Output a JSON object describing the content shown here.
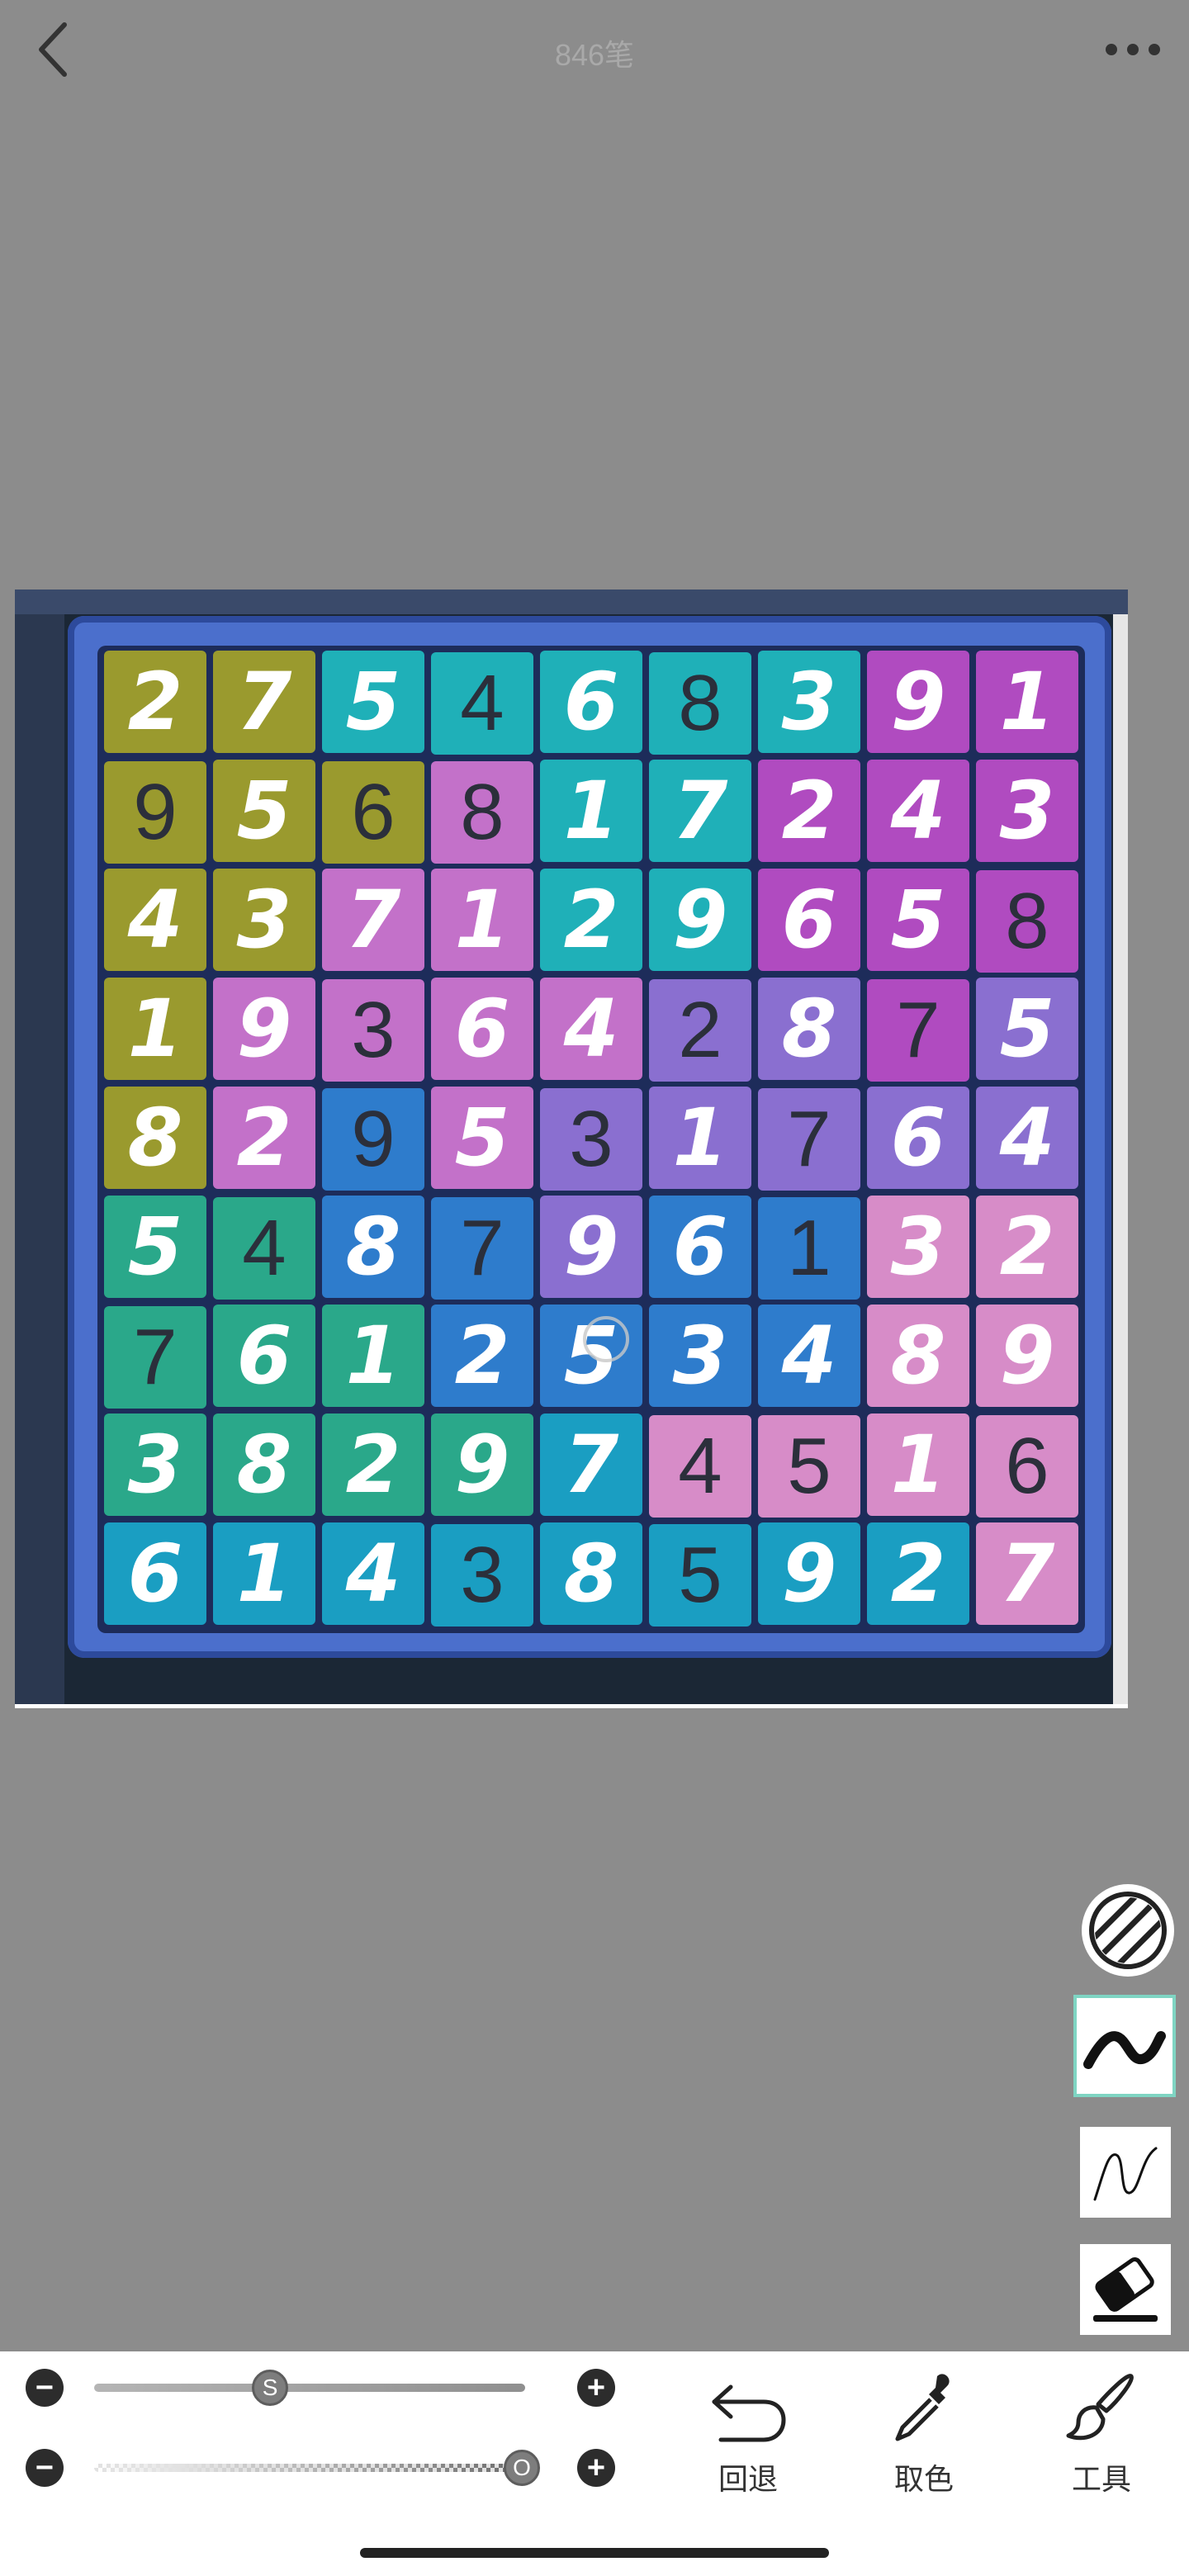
{
  "header": {
    "title": "846笔",
    "back_icon": "chevron-left-icon",
    "more_icon": "more-horizontal-icon"
  },
  "board": {
    "rows": [
      [
        {
          "d": "2",
          "h": true,
          "bg": "#9a9a2e"
        },
        {
          "d": "7",
          "h": true,
          "bg": "#9a9a2e"
        },
        {
          "d": "5",
          "h": true,
          "bg": "#1fb0b8"
        },
        {
          "d": "4",
          "h": false,
          "bg": "#1fb0b8"
        },
        {
          "d": "6",
          "h": true,
          "bg": "#1fb0b8"
        },
        {
          "d": "8",
          "h": false,
          "bg": "#1fb0b8"
        },
        {
          "d": "3",
          "h": true,
          "bg": "#1fb0b8"
        },
        {
          "d": "9",
          "h": true,
          "bg": "#b04bc0"
        },
        {
          "d": "1",
          "h": true,
          "bg": "#b04bc0"
        }
      ],
      [
        {
          "d": "9",
          "h": false,
          "bg": "#9a9a2e"
        },
        {
          "d": "5",
          "h": true,
          "bg": "#9a9a2e"
        },
        {
          "d": "6",
          "h": false,
          "bg": "#9a9a2e"
        },
        {
          "d": "8",
          "h": false,
          "bg": "#c371c9"
        },
        {
          "d": "1",
          "h": true,
          "bg": "#1fb0b8"
        },
        {
          "d": "7",
          "h": true,
          "bg": "#1fb0b8"
        },
        {
          "d": "2",
          "h": true,
          "bg": "#b04bc0"
        },
        {
          "d": "4",
          "h": true,
          "bg": "#b04bc0"
        },
        {
          "d": "3",
          "h": true,
          "bg": "#b04bc0"
        }
      ],
      [
        {
          "d": "4",
          "h": true,
          "bg": "#9a9a2e"
        },
        {
          "d": "3",
          "h": true,
          "bg": "#9a9a2e"
        },
        {
          "d": "7",
          "h": true,
          "bg": "#c371c9"
        },
        {
          "d": "1",
          "h": true,
          "bg": "#c371c9"
        },
        {
          "d": "2",
          "h": true,
          "bg": "#1fb0b8"
        },
        {
          "d": "9",
          "h": true,
          "bg": "#1fb0b8"
        },
        {
          "d": "6",
          "h": true,
          "bg": "#b04bc0"
        },
        {
          "d": "5",
          "h": true,
          "bg": "#b04bc0"
        },
        {
          "d": "8",
          "h": false,
          "bg": "#b04bc0"
        }
      ],
      [
        {
          "d": "1",
          "h": true,
          "bg": "#9a9a2e"
        },
        {
          "d": "9",
          "h": true,
          "bg": "#c371c9"
        },
        {
          "d": "3",
          "h": false,
          "bg": "#c371c9"
        },
        {
          "d": "6",
          "h": true,
          "bg": "#c371c9"
        },
        {
          "d": "4",
          "h": true,
          "bg": "#c371c9"
        },
        {
          "d": "2",
          "h": false,
          "bg": "#8a6fd0"
        },
        {
          "d": "8",
          "h": true,
          "bg": "#8a6fd0"
        },
        {
          "d": "7",
          "h": false,
          "bg": "#b04bc0"
        },
        {
          "d": "5",
          "h": true,
          "bg": "#8a6fd0"
        }
      ],
      [
        {
          "d": "8",
          "h": true,
          "bg": "#9a9a2e"
        },
        {
          "d": "2",
          "h": true,
          "bg": "#c371c9"
        },
        {
          "d": "9",
          "h": false,
          "bg": "#2e7ccc"
        },
        {
          "d": "5",
          "h": true,
          "bg": "#c371c9"
        },
        {
          "d": "3",
          "h": false,
          "bg": "#8a6fd0"
        },
        {
          "d": "1",
          "h": true,
          "bg": "#8a6fd0"
        },
        {
          "d": "7",
          "h": false,
          "bg": "#8a6fd0"
        },
        {
          "d": "6",
          "h": true,
          "bg": "#8a6fd0"
        },
        {
          "d": "4",
          "h": true,
          "bg": "#8a6fd0"
        }
      ],
      [
        {
          "d": "5",
          "h": true,
          "bg": "#2aa88a"
        },
        {
          "d": "4",
          "h": false,
          "bg": "#2aa88a"
        },
        {
          "d": "8",
          "h": true,
          "bg": "#2e7ccc"
        },
        {
          "d": "7",
          "h": false,
          "bg": "#2e7ccc"
        },
        {
          "d": "9",
          "h": true,
          "bg": "#8a6fd0"
        },
        {
          "d": "6",
          "h": true,
          "bg": "#2e7ccc"
        },
        {
          "d": "1",
          "h": false,
          "bg": "#2e7ccc"
        },
        {
          "d": "3",
          "h": true,
          "bg": "#d78cc8"
        },
        {
          "d": "2",
          "h": true,
          "bg": "#d78cc8"
        }
      ],
      [
        {
          "d": "7",
          "h": false,
          "bg": "#2aa88a"
        },
        {
          "d": "6",
          "h": true,
          "bg": "#2aa88a"
        },
        {
          "d": "1",
          "h": true,
          "bg": "#2aa88a"
        },
        {
          "d": "2",
          "h": true,
          "bg": "#2e7ccc"
        },
        {
          "d": "5",
          "h": true,
          "bg": "#2e7ccc"
        },
        {
          "d": "3",
          "h": true,
          "bg": "#2e7ccc"
        },
        {
          "d": "4",
          "h": true,
          "bg": "#2e7ccc"
        },
        {
          "d": "8",
          "h": true,
          "bg": "#d78cc8"
        },
        {
          "d": "9",
          "h": true,
          "bg": "#d78cc8"
        }
      ],
      [
        {
          "d": "3",
          "h": true,
          "bg": "#2aa88a"
        },
        {
          "d": "8",
          "h": true,
          "bg": "#2aa88a"
        },
        {
          "d": "2",
          "h": true,
          "bg": "#2aa88a"
        },
        {
          "d": "9",
          "h": true,
          "bg": "#2aa88a"
        },
        {
          "d": "7",
          "h": true,
          "bg": "#1a9ec2"
        },
        {
          "d": "4",
          "h": false,
          "bg": "#d78cc8"
        },
        {
          "d": "5",
          "h": false,
          "bg": "#d78cc8"
        },
        {
          "d": "1",
          "h": true,
          "bg": "#d78cc8"
        },
        {
          "d": "6",
          "h": false,
          "bg": "#d78cc8"
        }
      ],
      [
        {
          "d": "6",
          "h": true,
          "bg": "#1a9ec2"
        },
        {
          "d": "1",
          "h": true,
          "bg": "#1a9ec2"
        },
        {
          "d": "4",
          "h": true,
          "bg": "#1a9ec2"
        },
        {
          "d": "3",
          "h": false,
          "bg": "#1a9ec2"
        },
        {
          "d": "8",
          "h": true,
          "bg": "#1a9ec2"
        },
        {
          "d": "5",
          "h": false,
          "bg": "#1a9ec2"
        },
        {
          "d": "9",
          "h": true,
          "bg": "#1a9ec2"
        },
        {
          "d": "2",
          "h": true,
          "bg": "#1a9ec2"
        },
        {
          "d": "7",
          "h": true,
          "bg": "#d78cc8"
        }
      ]
    ]
  },
  "tools": {
    "pattern_icon": "hatch-pattern-icon",
    "brush_thick_icon": "brush-thick-icon",
    "brush_thin_icon": "brush-thin-icon",
    "eraser_icon": "eraser-icon"
  },
  "sliders": {
    "size": {
      "knob_label": "S",
      "value": 0.37
    },
    "opacity": {
      "knob_label": "O",
      "value": 1.0
    }
  },
  "actions": {
    "undo": {
      "label": "回退",
      "icon": "undo-icon"
    },
    "picker": {
      "label": "取色",
      "icon": "eyedropper-icon"
    },
    "tools": {
      "label": "工具",
      "icon": "brush-tool-icon"
    }
  }
}
